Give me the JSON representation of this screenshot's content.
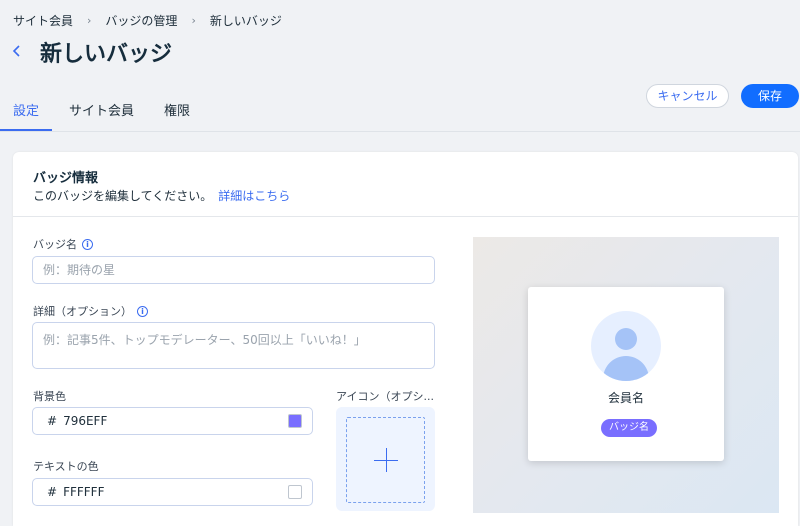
{
  "breadcrumb": [
    "サイト会員",
    "バッジの管理",
    "新しいバッジ"
  ],
  "page": {
    "title": "新しいバッジ"
  },
  "tabs": [
    {
      "label": "設定",
      "active": true
    },
    {
      "label": "サイト会員",
      "active": false
    },
    {
      "label": "権限",
      "active": false
    }
  ],
  "actions": {
    "cancel": "キャンセル",
    "save": "保存"
  },
  "card": {
    "title": "バッジ情報",
    "subtitle": "このバッジを編集してください。",
    "link": "詳細はこちら"
  },
  "form": {
    "name": {
      "label": "バッジ名",
      "placeholder": "例：期待の星",
      "value": ""
    },
    "details": {
      "label": "詳細（オプション）",
      "placeholder": "例：記事5件、トップモデレーター、50回以上「いいね！」",
      "value": ""
    },
    "bg_color": {
      "label": "背景色",
      "hash": "#",
      "value": "796EFF",
      "swatch": "#796EFF"
    },
    "text_color": {
      "label": "テキストの色",
      "hash": "#",
      "value": "FFFFFF",
      "swatch": "#FFFFFF"
    },
    "icon": {
      "label": "アイコン（オプシ..."
    }
  },
  "preview": {
    "member_name": "会員名",
    "badge_label": "バッジ名",
    "badge_bg": "#796EFF",
    "badge_fg": "#FFFFFF"
  },
  "icons": {
    "back": "chevron-left-icon",
    "separator": "chevron-right-icon",
    "info": "info-icon",
    "add": "plus-icon",
    "avatar": "user-avatar-icon"
  },
  "colors": {
    "accent": "#3B6CF0",
    "primary_button": "#116DFF"
  }
}
